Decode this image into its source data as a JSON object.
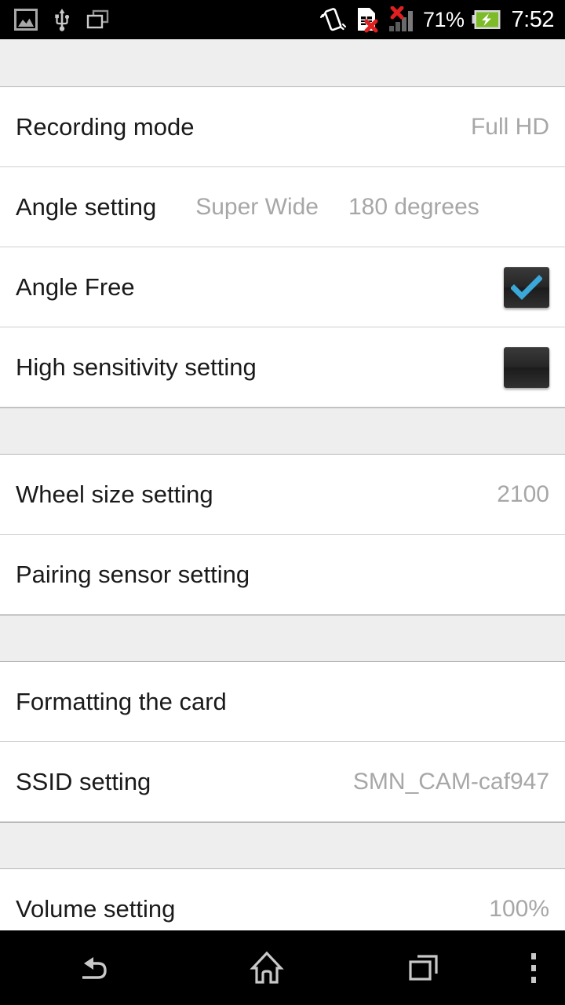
{
  "status_bar": {
    "left_icons": [
      {
        "name": "photo-icon",
        "label": "Screenshot captured"
      },
      {
        "name": "usb-icon",
        "label": "USB connected"
      },
      {
        "name": "screen-mirror-icon",
        "label": "Screen mirroring"
      }
    ],
    "right_icons": [
      {
        "name": "vibrate-icon",
        "label": "Vibrate mode"
      },
      {
        "name": "sim-card-error-icon",
        "label": "No SIM card"
      },
      {
        "name": "signal-no-service-icon",
        "label": "No signal"
      },
      {
        "name": "battery-charging-icon",
        "label": "Battery charging"
      }
    ],
    "battery_percent": "71%",
    "clock": "7:52",
    "colors": {
      "background": "#000000",
      "text": "#ffffff",
      "error": "#e02020",
      "battery_green": "#7dbb28"
    }
  },
  "settings_list": {
    "groups": [
      {
        "items": [
          {
            "name": "recording-mode",
            "label": "Recording mode",
            "value": "Full HD",
            "type": "value"
          },
          {
            "name": "angle-setting",
            "label": "Angle setting",
            "value": "Super Wide",
            "value2": "180 degrees",
            "type": "value-multi"
          },
          {
            "name": "angle-free",
            "label": "Angle Free",
            "checked": true,
            "type": "checkbox"
          },
          {
            "name": "high-sensitivity-setting",
            "label": "High sensitivity setting",
            "checked": false,
            "type": "checkbox"
          }
        ]
      },
      {
        "items": [
          {
            "name": "wheel-size-setting",
            "label": "Wheel size setting",
            "value": "2100",
            "type": "value"
          },
          {
            "name": "pairing-sensor-setting",
            "label": "Pairing sensor setting",
            "value": "",
            "type": "plain"
          }
        ]
      },
      {
        "items": [
          {
            "name": "formatting-the-card",
            "label": "Formatting the card",
            "value": "",
            "type": "plain"
          },
          {
            "name": "ssid-setting",
            "label": "SSID setting",
            "value": "SMN_CAM-caf947",
            "type": "value"
          }
        ]
      },
      {
        "items": [
          {
            "name": "volume-setting",
            "label": "Volume setting",
            "value": "100%",
            "type": "value"
          }
        ]
      }
    ],
    "colors": {
      "row_background": "#ffffff",
      "separator_background": "#eeeeee",
      "divider": "#cfcfcf",
      "title_text": "#1a1a1a",
      "value_text": "#a7a7a7",
      "checkbox_fill": "#2a2a2a",
      "checkbox_check": "#3aa8d8"
    }
  },
  "nav_bar": {
    "buttons": [
      {
        "name": "back-button",
        "label": "Back"
      },
      {
        "name": "home-button",
        "label": "Home"
      },
      {
        "name": "recents-button",
        "label": "Recent apps"
      },
      {
        "name": "overflow-menu-button",
        "label": "More options"
      }
    ],
    "colors": {
      "background": "#000000",
      "icon": "#c8c8c8"
    }
  }
}
